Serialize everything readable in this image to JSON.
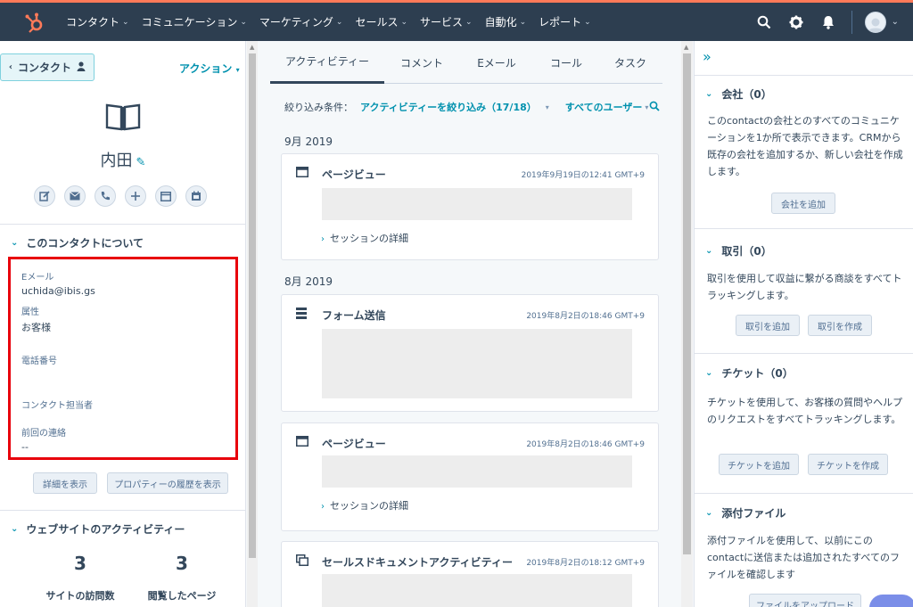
{
  "nav": {
    "items": [
      "コンタクト",
      "コミュニケーション",
      "マーケティング",
      "セールス",
      "サービス",
      "自動化",
      "レポート"
    ]
  },
  "left": {
    "back_label": "コンタクト",
    "action_label": "アクション",
    "contact_name": "内田",
    "about": {
      "header": "このコンタクトについて",
      "fields": [
        {
          "label": "Eメール",
          "value": "uchida@ibis.gs"
        },
        {
          "label": "属性",
          "value": "お客様"
        },
        {
          "label": "電話番号",
          "value": ""
        },
        {
          "label": "コンタクト担当者",
          "value": ""
        },
        {
          "label": "前回の連絡",
          "value": "--"
        }
      ]
    },
    "buttons": {
      "details": "詳細を表示",
      "history": "プロパティーの履歴を表示"
    },
    "website": {
      "header": "ウェブサイトのアクティビティー",
      "visits": {
        "value": "3",
        "label": "サイトの訪問数"
      },
      "pages": {
        "value": "3",
        "label": "閲覧したページ"
      }
    }
  },
  "middle": {
    "tabs": [
      "アクティビティー",
      "コメント",
      "Eメール",
      "コール",
      "タスク"
    ],
    "filter": {
      "label": "絞り込み条件：",
      "activity": "アクティビティーを絞り込み（17/18）",
      "users": "すべてのユーザー"
    },
    "months": [
      "9月 2019",
      "8月 2019"
    ],
    "cards": [
      {
        "title": "ページビュー",
        "time": "2019年9月19日の12:41 GMT+9",
        "detail": "セッションの詳細"
      },
      {
        "title": "フォーム送信",
        "time": "2019年8月2日の18:46 GMT+9"
      },
      {
        "title": "ページビュー",
        "time": "2019年8月2日の18:46 GMT+9",
        "detail": "セッションの詳細"
      },
      {
        "title": "セールスドキュメントアクティビティー",
        "time": "2019年8月2日の18:12 GMT+9"
      }
    ]
  },
  "right": {
    "company": {
      "header": "会社（0）",
      "text": "このcontactの会社とのすべてのコミュニケーションを1か所で表示できます。CRMから既存の会社を追加するか、新しい会社を作成します。",
      "button": "会社を追加"
    },
    "deals": {
      "header": "取引（0）",
      "text": "取引を使用して収益に繋がる商談をすべてトラッキングします。",
      "button_add": "取引を追加",
      "button_create": "取引を作成"
    },
    "tickets": {
      "header": "チケット（0）",
      "text": "チケットを使用して、お客様の質問やヘルプのリクエストをすべてトラッキングします。",
      "button_add": "チケットを追加",
      "button_create": "チケットを作成"
    },
    "files": {
      "header": "添付ファイル",
      "text": "添付ファイルを使用して、以前にこのcontactに送信または追加されたすべてのファイルを確認します",
      "button": "ファイルをアップロード"
    }
  }
}
